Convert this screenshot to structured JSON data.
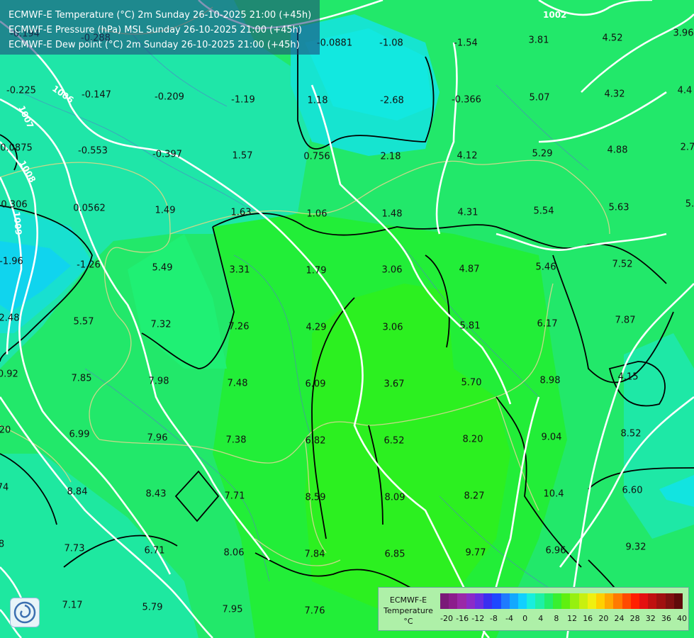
{
  "header": {
    "line1": "ECMWF-E Temperature (°C) 2m Sunday 26-10-2025 21:00 (+45h)",
    "line2": "ECMWF-E Pressure (hPa) MSL Sunday 26-10-2025 21:00 (+45h)",
    "line3": "ECMWF-E Dew point (°C) 2m Sunday 26-10-2025 21:00 (+45h)"
  },
  "isobar_labels": [
    "1002",
    "1006",
    "1007",
    "1008",
    "1009"
  ],
  "values": [
    "-0.194",
    "-0.288",
    "-0.0881",
    "-1.08",
    "-1.54",
    "3.81",
    "4.52",
    "3.96",
    "-0.225",
    "-0.147",
    "-0.209",
    "-1.19",
    "1.18",
    "-2.68",
    "-0.366",
    "5.07",
    "4.32",
    "4.4",
    "0.0875",
    "-0.553",
    "-0.397",
    "1.57",
    "0.756",
    "2.18",
    "4.12",
    "5.29",
    "4.88",
    "2.7",
    "0.306",
    "0.0562",
    "1.49",
    "1.63",
    "1.06",
    "1.48",
    "4.31",
    "5.54",
    "5.63",
    "5.",
    "-1.96",
    "-1.26",
    "5.49",
    "3.31",
    "1.79",
    "3.06",
    "4.87",
    "5.46",
    "7.52",
    "2.48",
    "5.57",
    "7.32",
    "7.26",
    "4.29",
    "3.06",
    "5.81",
    "6.17",
    "7.87",
    "-0.92",
    "7.85",
    "7.98",
    "7.48",
    "6.09",
    "3.67",
    "5.70",
    "8.98",
    "4.15",
    "20",
    "6.99",
    "7.96",
    "7.38",
    "6.82",
    "6.52",
    "8.20",
    "9.04",
    "8.52",
    "74",
    "8.84",
    "8.43",
    "7.71",
    "8.59",
    "8.09",
    "8.27",
    "10.4",
    "6.60",
    "8",
    "7.73",
    "6.71",
    "8.06",
    "7.84",
    "6.85",
    "9.77",
    "6.96",
    "9.32",
    "7.17",
    "5.79",
    "7.95",
    "7.76"
  ],
  "legend": {
    "title_line1": "ECMWF-E",
    "title_line2": "Temperature",
    "title_line3": "°C",
    "ticks": [
      "-20",
      "-16",
      "-12",
      "-8",
      "-4",
      "0",
      "4",
      "8",
      "12",
      "16",
      "20",
      "24",
      "28",
      "32",
      "36",
      "40"
    ],
    "colors": [
      "#7a1a78",
      "#8c1d8c",
      "#9a28a8",
      "#8a2bc8",
      "#6a2ee0",
      "#3a2ff0",
      "#1e48ff",
      "#1e7bff",
      "#12a8ff",
      "#10d0ff",
      "#18eedd",
      "#1ef0a6",
      "#22ee6a",
      "#38f030",
      "#5ff010",
      "#96f010",
      "#c8f010",
      "#f0f010",
      "#ffd000",
      "#ffa800",
      "#ff7a00",
      "#ff4a00",
      "#ff2000",
      "#e41010",
      "#c01010",
      "#a01010",
      "#801010",
      "#600a0a"
    ]
  },
  "colors": {
    "field_base": "#22e86a",
    "cold_region": "#16ddd8",
    "colder_region": "#10c8f0",
    "warm_region": "#22ee30",
    "isobar": "#ffffff",
    "isotherm": "#000000",
    "border": "#c8d88a",
    "river": "#5577cc"
  }
}
